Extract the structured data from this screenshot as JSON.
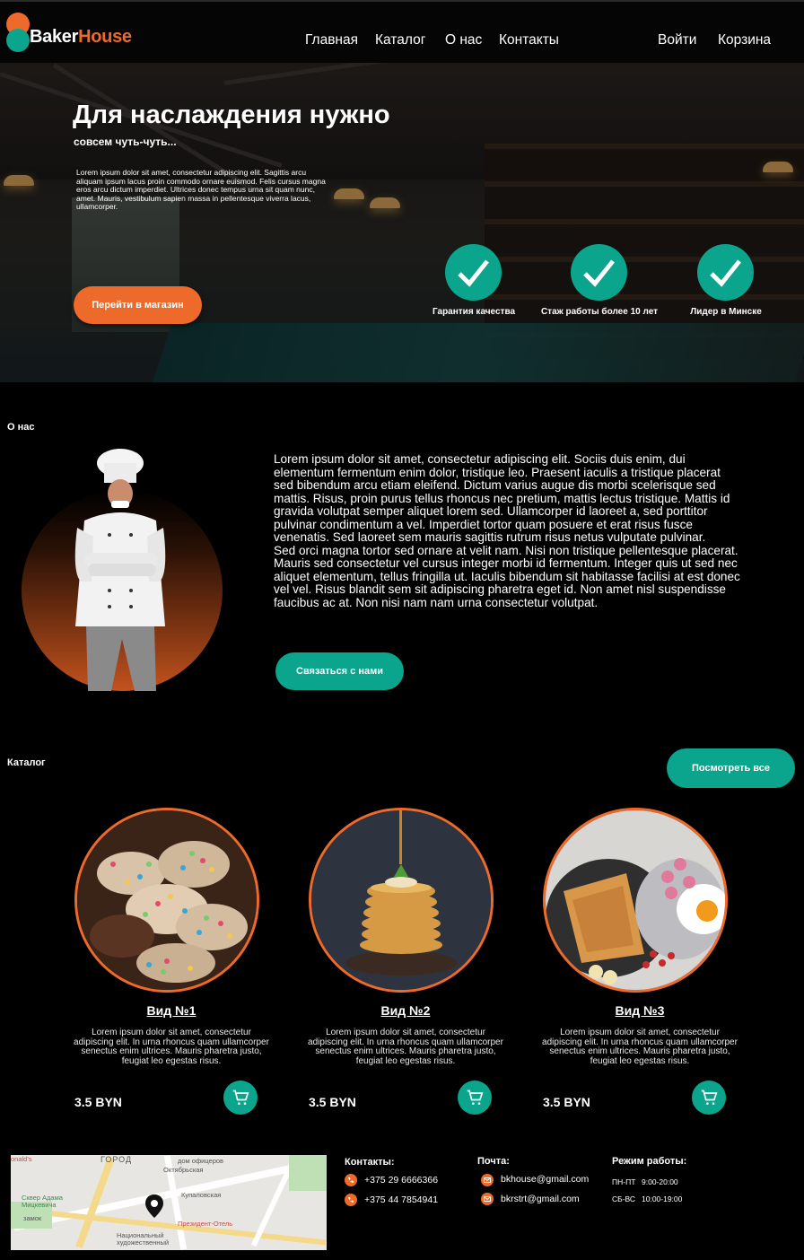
{
  "brand": {
    "part1": "Baker",
    "part2": "House",
    "accent": "#ee6a2b",
    "teal": "#0aa58c"
  },
  "nav": {
    "home": "Главная",
    "catalog": "Каталог",
    "about": "О нас",
    "contacts": "Контакты",
    "login": "Войти",
    "cart": "Корзина"
  },
  "hero": {
    "title": "Для наслаждения нужно",
    "subtitle": "совсем чуть-чуть...",
    "text": "Lorem ipsum dolor sit amet, consectetur adipiscing elit. Sagittis arcu aliquam ipsum lacus proin commodo ornare euismod. Felis cursus magna eros arcu dictum imperdiet. Ultrices donec tempus urna sit quam nunc, amet. Mauris, vestibulum sapien massa in pellentesque viverra lacus, ullamcorper.",
    "button": "Перейти в магазин",
    "features": [
      "Гарантия качества",
      "Стаж работы более 10 лет",
      "Лидер в Минске"
    ]
  },
  "about": {
    "title": "О нас",
    "text": "Lorem ipsum dolor sit amet, consectetur adipiscing elit. Sociis duis enim, dui elementum fermentum enim dolor, tristique leo. Praesent iaculis a tristique placerat sed bibendum arcu etiam eleifend. Dictum varius augue dis morbi scelerisque sed mattis. Risus, proin purus tellus rhoncus nec pretium, mattis lectus tristique. Mattis id gravida volutpat semper aliquet lorem sed. Ullamcorper id laoreet a, sed porttitor pulvinar condimentum a vel. Imperdiet tortor quam posuere et erat risus fusce venenatis. Sed laoreet sem mauris sagittis rutrum risus netus vulputate pulvinar.\nSed orci magna tortor sed ornare at velit nam. Nisi non tristique pellentesque placerat. Mauris sed consectetur vel cursus integer morbi id fermentum. Integer quis ut sed nec aliquet elementum, tellus fringilla ut. Iaculis bibendum sit habitasse facilisi at est donec vel vel. Risus blandit sem sit adipiscing pharetra eget id. Non amet nisl suspendisse faucibus ac at. Non nisi nam nam urna consectetur volutpat.",
    "button": "Связаться с нами"
  },
  "catalog": {
    "title": "Каталог",
    "view_all": "Посмотреть все",
    "items": [
      {
        "name": "Вид №1",
        "desc": "Lorem ipsum dolor sit amet, consectetur adipiscing elit. In urna rhoncus quam ullamcorper senectus enim ultrices. Mauris pharetra justo, feugiat leo egestas risus.",
        "price": "3.5 BYN"
      },
      {
        "name": "Вид №2",
        "desc": "Lorem ipsum dolor sit amet, consectetur adipiscing elit. In urna rhoncus quam ullamcorper senectus enim ultrices. Mauris pharetra justo, feugiat leo egestas risus.",
        "price": "3.5 BYN"
      },
      {
        "name": "Вид №3",
        "desc": "Lorem ipsum dolor sit amet, consectetur adipiscing elit. In urna rhoncus quam ullamcorper senectus enim ultrices. Mauris pharetra justo, feugiat leo egestas risus.",
        "price": "3.5 BYN"
      }
    ]
  },
  "footer": {
    "map_labels": [
      "onald's",
      "ГОРОД",
      "дом офицеров",
      "Октябрьская",
      "Сквер Адама Мицкевича",
      "Купаловская",
      "Президент-Отель",
      "Национальный художественный",
      "замок"
    ],
    "contacts_title": "Контакты:",
    "phones": [
      "+375 29 6666366",
      "+375 44 7854941"
    ],
    "mail_title": "Почта:",
    "emails": [
      "bkhouse@gmail.com",
      "bkrstrt@gmail.com"
    ],
    "hours_title": "Режим работы:",
    "hours": [
      {
        "days": "ПН-ПТ",
        "time": "9:00-20:00"
      },
      {
        "days": "СБ-ВС",
        "time": "10:00-19:00"
      }
    ]
  }
}
